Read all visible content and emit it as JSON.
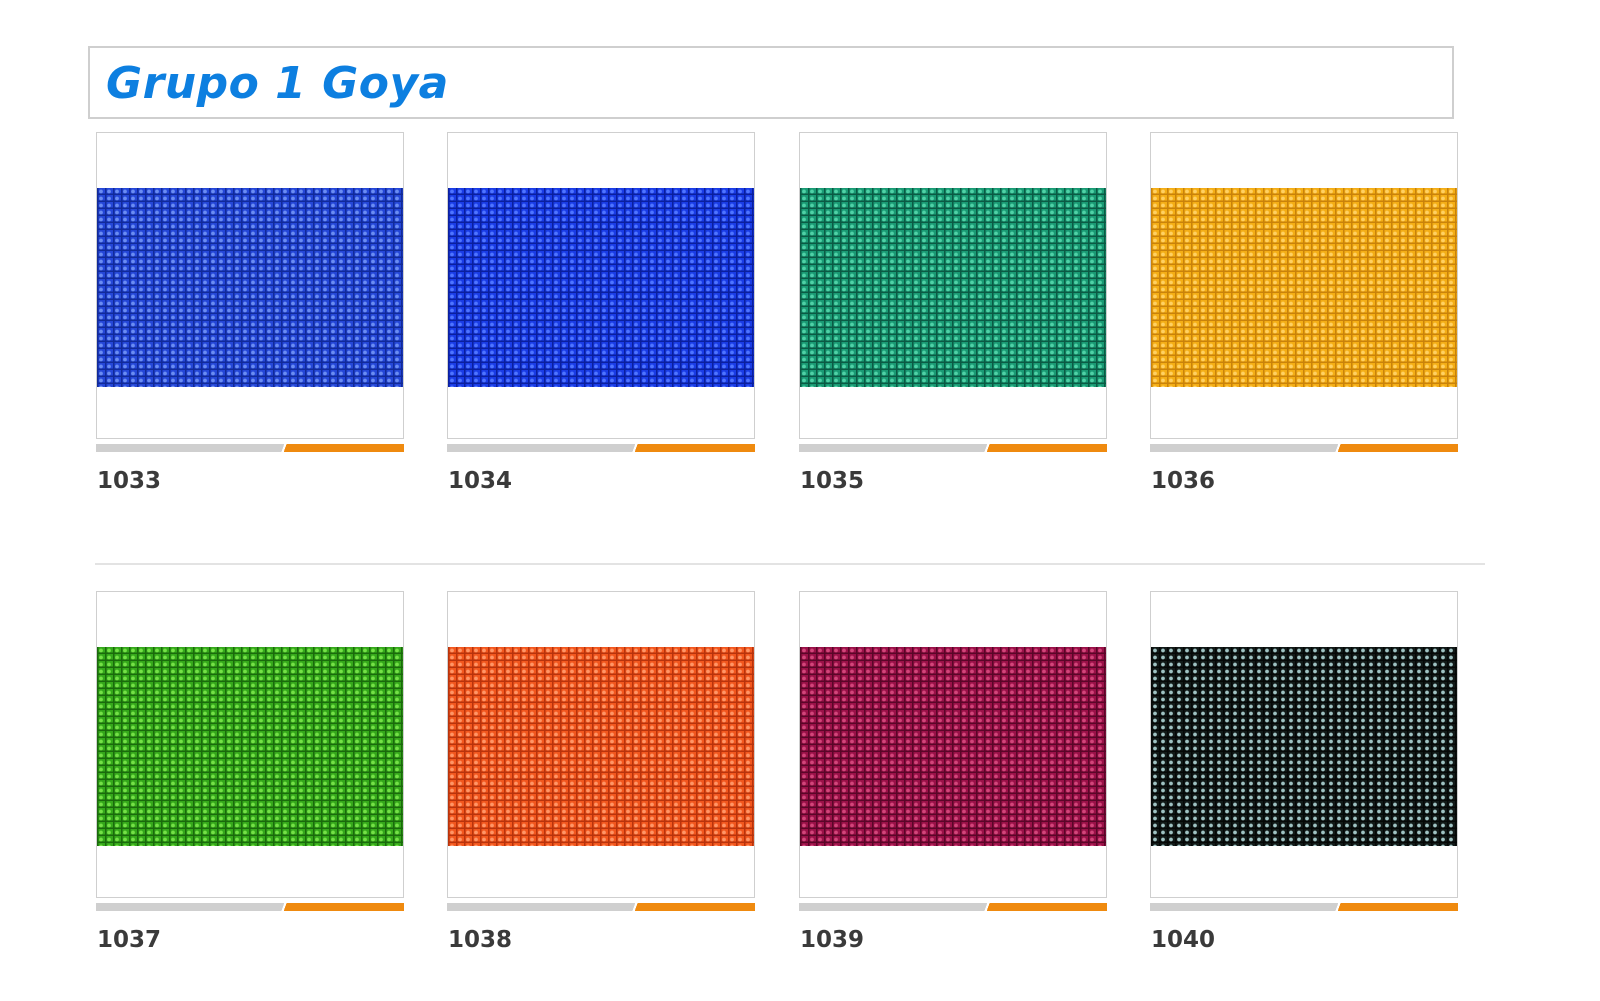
{
  "title": "Grupo 1 Goya",
  "swatches": [
    {
      "code": "1033",
      "color": "#2547d8",
      "weave": "#6a8cf2",
      "shadow": "#112a99"
    },
    {
      "code": "1034",
      "color": "#1a3ce6",
      "weave": "#4e74ff",
      "shadow": "#0a1f9e"
    },
    {
      "code": "1035",
      "color": "#1a9a74",
      "weave": "#4fd1a6",
      "shadow": "#0b5a44"
    },
    {
      "code": "1036",
      "color": "#f4ae16",
      "weave": "#ffd062",
      "shadow": "#c9820a"
    },
    {
      "code": "1037",
      "color": "#35a81b",
      "weave": "#74e046",
      "shadow": "#1a6a0c"
    },
    {
      "code": "1038",
      "color": "#f2571e",
      "weave": "#ff9566",
      "shadow": "#b8330c"
    },
    {
      "code": "1039",
      "color": "#9a1148",
      "weave": "#d2457a",
      "shadow": "#5a0628"
    },
    {
      "code": "1040",
      "color": "#121a18",
      "weave": "#9fc2c2",
      "shadow": "#050807"
    }
  ]
}
